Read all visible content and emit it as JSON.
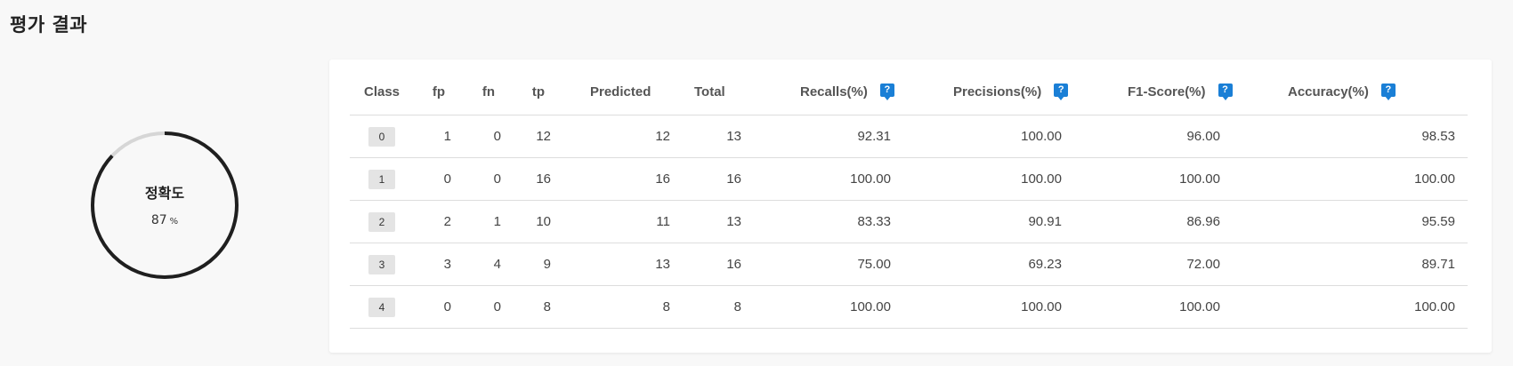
{
  "page": {
    "title": "평가 결과"
  },
  "accuracy": {
    "label": "정확도",
    "value": "87",
    "unit": "%",
    "fraction": 0.87
  },
  "table": {
    "headers": {
      "class": "Class",
      "fp": "fp",
      "fn": "fn",
      "tp": "tp",
      "predicted": "Predicted",
      "total": "Total",
      "recalls": "Recalls(%)",
      "precisions": "Precisions(%)",
      "f1": "F1-Score(%)",
      "accuracy": "Accuracy(%)"
    },
    "help_icon": "?",
    "rows": [
      {
        "class": "0",
        "fp": "1",
        "fn": "0",
        "tp": "12",
        "predicted": "12",
        "total": "13",
        "recall": "92.31",
        "precision": "100.00",
        "f1": "96.00",
        "accuracy": "98.53"
      },
      {
        "class": "1",
        "fp": "0",
        "fn": "0",
        "tp": "16",
        "predicted": "16",
        "total": "16",
        "recall": "100.00",
        "precision": "100.00",
        "f1": "100.00",
        "accuracy": "100.00"
      },
      {
        "class": "2",
        "fp": "2",
        "fn": "1",
        "tp": "10",
        "predicted": "11",
        "total": "13",
        "recall": "83.33",
        "precision": "90.91",
        "f1": "86.96",
        "accuracy": "95.59"
      },
      {
        "class": "3",
        "fp": "3",
        "fn": "4",
        "tp": "9",
        "predicted": "13",
        "total": "16",
        "recall": "75.00",
        "precision": "69.23",
        "f1": "72.00",
        "accuracy": "89.71"
      },
      {
        "class": "4",
        "fp": "0",
        "fn": "0",
        "tp": "8",
        "predicted": "8",
        "total": "8",
        "recall": "100.00",
        "precision": "100.00",
        "f1": "100.00",
        "accuracy": "100.00"
      }
    ]
  },
  "colors": {
    "gauge_fill": "#1f1f1f",
    "gauge_track": "#d6d6d6",
    "help_icon": "#1a7fd6"
  }
}
